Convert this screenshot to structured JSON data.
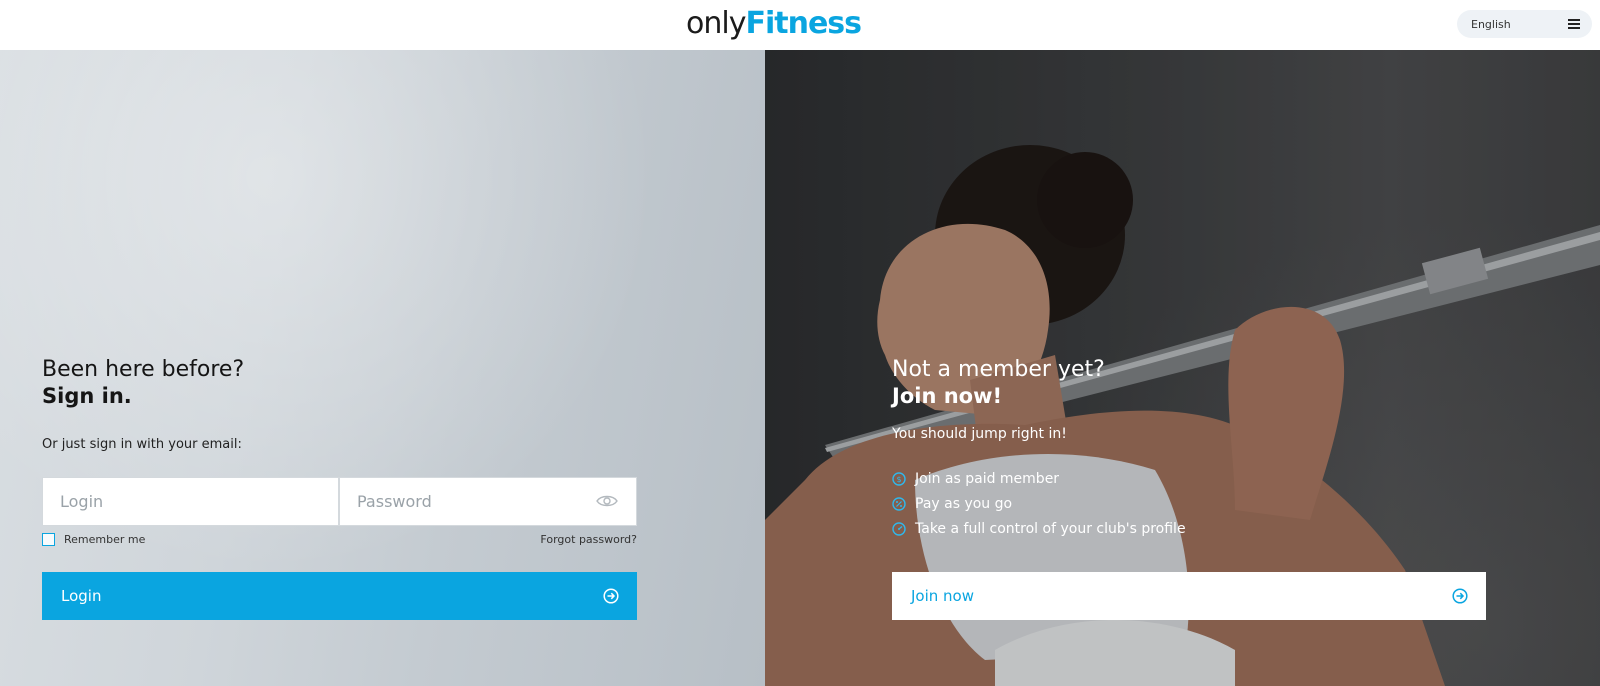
{
  "header": {
    "logo": {
      "part1": "only",
      "part2": "Fitness"
    },
    "language": {
      "label": "English",
      "icon": "menu-icon"
    }
  },
  "signin": {
    "title": "Been here before?",
    "title_strong": "Sign in.",
    "email_hint": "Or just sign in with your email:",
    "login_field": {
      "placeholder": "Login",
      "value": ""
    },
    "password_field": {
      "placeholder": "Password",
      "value": "",
      "icon": "eye-icon"
    },
    "remember_label": "Remember me",
    "remember_checked": false,
    "forgot_label": "Forgot password?",
    "login_button": "Login",
    "login_button_icon": "arrow-right-circle-icon"
  },
  "join": {
    "title": "Not a member yet?",
    "title_strong": "Join now!",
    "subtitle": "You should jump right in!",
    "features": [
      {
        "label": "Join as paid member",
        "icon": "dollar-circle-icon"
      },
      {
        "label": "Pay as you go",
        "icon": "percent-circle-icon"
      },
      {
        "label": "Take a full control of your club's profile",
        "icon": "gauge-circle-icon"
      }
    ],
    "join_button": "Join now",
    "join_button_icon": "arrow-right-circle-icon"
  },
  "colors": {
    "accent": "#0aa5e0",
    "text_dark": "#151515",
    "white": "#ffffff"
  }
}
